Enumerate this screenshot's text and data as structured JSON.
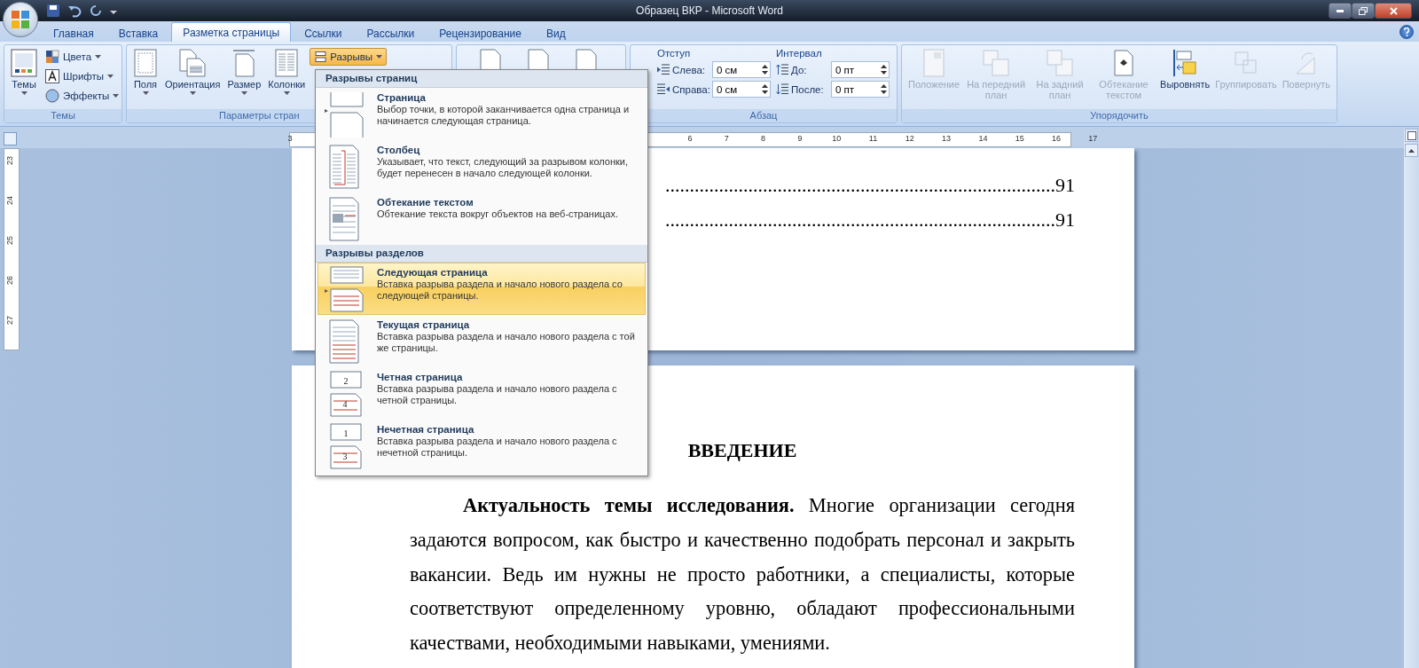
{
  "window": {
    "title": "Образец ВКР - Microsoft Word"
  },
  "tabs": [
    {
      "label": "Главная",
      "selected": false
    },
    {
      "label": "Вставка",
      "selected": false
    },
    {
      "label": "Разметка страницы",
      "selected": true
    },
    {
      "label": "Ссылки",
      "selected": false
    },
    {
      "label": "Рассылки",
      "selected": false
    },
    {
      "label": "Рецензирование",
      "selected": false
    },
    {
      "label": "Вид",
      "selected": false
    }
  ],
  "ribbon": {
    "themes": {
      "label": "Темы",
      "big": "Темы",
      "items": [
        {
          "kind": "colors",
          "label": "Цвета"
        },
        {
          "kind": "fonts",
          "label": "Шрифты"
        },
        {
          "kind": "effects",
          "label": "Эффекты"
        }
      ]
    },
    "page_setup": {
      "label": "Параметры стран",
      "buttons": [
        {
          "kind": "margins",
          "label": "Поля"
        },
        {
          "kind": "orientation",
          "label": "Ориентация"
        },
        {
          "kind": "size",
          "label": "Размер"
        },
        {
          "kind": "columns",
          "label": "Колонки"
        }
      ],
      "breaks": {
        "label": "Разрывы",
        "expanded": true
      }
    },
    "paragraph": {
      "label": "Абзац",
      "indent": {
        "title": "Отступ",
        "fields": [
          {
            "kind": "left",
            "label": "Слева:",
            "value": "0 см"
          },
          {
            "kind": "right",
            "label": "Справа:",
            "value": "0 см"
          }
        ]
      },
      "spacing": {
        "title": "Интервал",
        "fields": [
          {
            "kind": "before",
            "label": "До:",
            "value": "0 пт"
          },
          {
            "kind": "after",
            "label": "После:",
            "value": "0 пт"
          }
        ]
      }
    },
    "arrange": {
      "label": "Упорядочить",
      "buttons": [
        {
          "kind": "position",
          "label": "Положение",
          "disabled": true
        },
        {
          "kind": "front",
          "label": "На передний план",
          "disabled": true
        },
        {
          "kind": "back",
          "label": "На задний план",
          "disabled": true
        },
        {
          "kind": "wrap",
          "label": "Обтекание текстом",
          "disabled": true
        },
        {
          "kind": "align",
          "label": "Выровнять",
          "disabled": false
        },
        {
          "kind": "group",
          "label": "Группировать",
          "disabled": true
        },
        {
          "kind": "rotate",
          "label": "Повернуть",
          "disabled": true
        }
      ]
    }
  },
  "ruler": {
    "horizontal": [
      "3",
      "6",
      "7",
      "8",
      "9",
      "10",
      "11",
      "12",
      "13",
      "14",
      "15",
      "16",
      "17"
    ],
    "vertical": [
      "23",
      "24",
      "25",
      "26",
      "27"
    ]
  },
  "breaks_menu": {
    "sections": [
      {
        "title": "Разрывы страниц",
        "items": [
          {
            "kind": "page",
            "title": "Страница",
            "description": "Выбор точки, в которой заканчивается одна страница и начинается следующая страница.",
            "selected": false
          },
          {
            "kind": "column",
            "title": "Столбец",
            "description": "Указывает, что текст, следующий за разрывом колонки, будет перенесен в начало следующей колонки.",
            "selected": false
          },
          {
            "kind": "wrap",
            "title": "Обтекание текстом",
            "description": "Обтекание текста вокруг объектов на веб-страницах.",
            "selected": false
          }
        ]
      },
      {
        "title": "Разрывы разделов",
        "items": [
          {
            "kind": "next",
            "title": "Следующая страница",
            "description": "Вставка разрыва раздела и начало нового раздела со следующей страницы.",
            "selected": true
          },
          {
            "kind": "current",
            "title": "Текущая страница",
            "description": "Вставка разрыва раздела и начало нового раздела с той же страницы.",
            "selected": false
          },
          {
            "kind": "numbered",
            "title": "Четная страница",
            "description": "Вставка разрыва раздела и начало нового раздела с четной страницы.",
            "numbers": [
              "2",
              "4"
            ],
            "selected": false
          },
          {
            "kind": "numbered",
            "title": "Нечетная страница",
            "description": "Вставка разрыва раздела и начало нового раздела с нечетной страницы.",
            "numbers": [
              "1",
              "3"
            ],
            "selected": false
          }
        ]
      }
    ]
  },
  "document": {
    "toc_lines": [
      {
        "leader": "................................................................................",
        "page": "91"
      },
      {
        "leader": "................................................................................",
        "page": "91"
      }
    ],
    "heading": "ВВЕДЕНИЕ",
    "paragraph": "**Актуальность темы исследования.** Многие организации сегодня задаются вопросом, как быстро и качественно подобрать персонал и закрыть вакансии. Ведь им нужны не просто работники, а специалисты, которые соответствуют определенному уровню, обладают профессиональными качествами, необходимыми навыками, умениями."
  }
}
